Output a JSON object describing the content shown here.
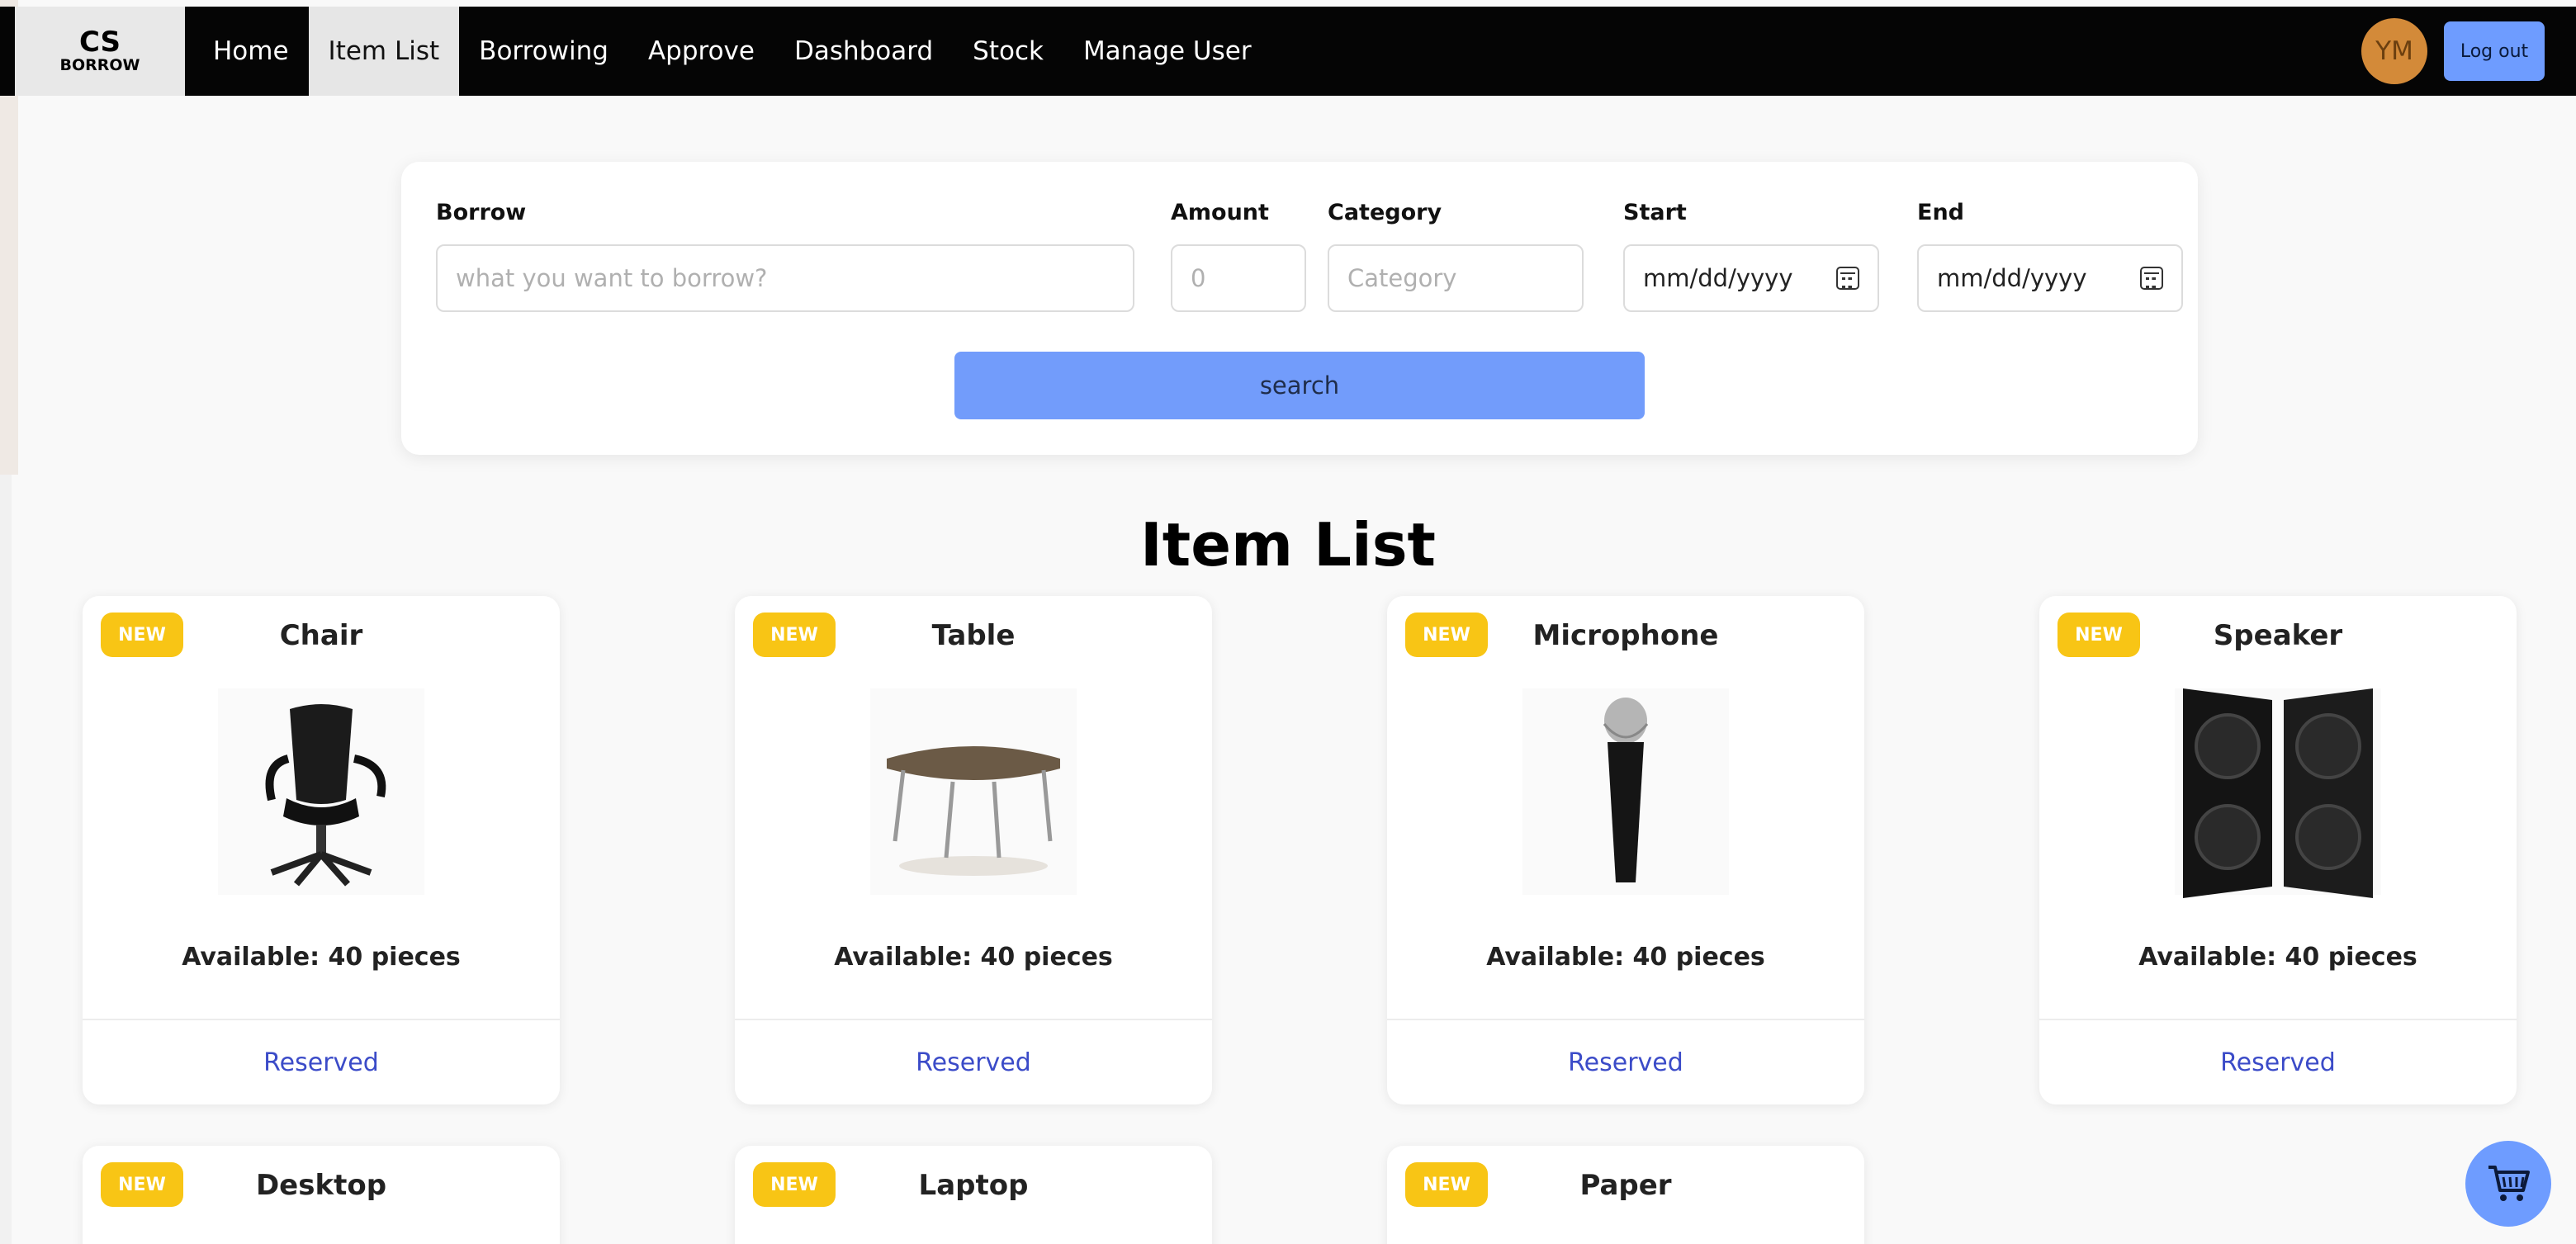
{
  "brand": {
    "line1": "CS",
    "line2": "BORROW"
  },
  "nav": {
    "items": [
      {
        "label": "Home",
        "active": false
      },
      {
        "label": "Item List",
        "active": true
      },
      {
        "label": "Borrowing",
        "active": false
      },
      {
        "label": "Approve",
        "active": false
      },
      {
        "label": "Dashboard",
        "active": false
      },
      {
        "label": "Stock",
        "active": false
      },
      {
        "label": "Manage User",
        "active": false
      }
    ],
    "avatar_initials": "YM",
    "logout_label": "Log out"
  },
  "search": {
    "borrow_label": "Borrow",
    "borrow_placeholder": "what you want to borrow?",
    "amount_label": "Amount",
    "amount_placeholder": "0",
    "category_label": "Category",
    "category_placeholder": "Category",
    "start_label": "Start",
    "start_value": "mm/dd/yyyy",
    "end_label": "End",
    "end_value": "mm/dd/yyyy",
    "button_label": "search"
  },
  "page_title": "Item List",
  "items": [
    {
      "badge": "NEW",
      "name": "Chair",
      "available": "Available: 40 pieces",
      "action": "Reserved",
      "icon": "chair-image"
    },
    {
      "badge": "NEW",
      "name": "Table",
      "available": "Available: 40 pieces",
      "action": "Reserved",
      "icon": "table-image"
    },
    {
      "badge": "NEW",
      "name": "Microphone",
      "available": "Available: 40 pieces",
      "action": "Reserved",
      "icon": "microphone-image"
    },
    {
      "badge": "NEW",
      "name": "Speaker",
      "available": "Available: 40 pieces",
      "action": "Reserved",
      "icon": "speaker-image"
    },
    {
      "badge": "NEW",
      "name": "Desktop"
    },
    {
      "badge": "NEW",
      "name": "Laptop"
    },
    {
      "badge": "NEW",
      "name": "Paper"
    }
  ],
  "colors": {
    "navbar": "#050505",
    "accent_button": "#729cfb",
    "badge": "#f8c515",
    "reserved_link": "#3b4bc8",
    "avatar": "#d38a39"
  }
}
